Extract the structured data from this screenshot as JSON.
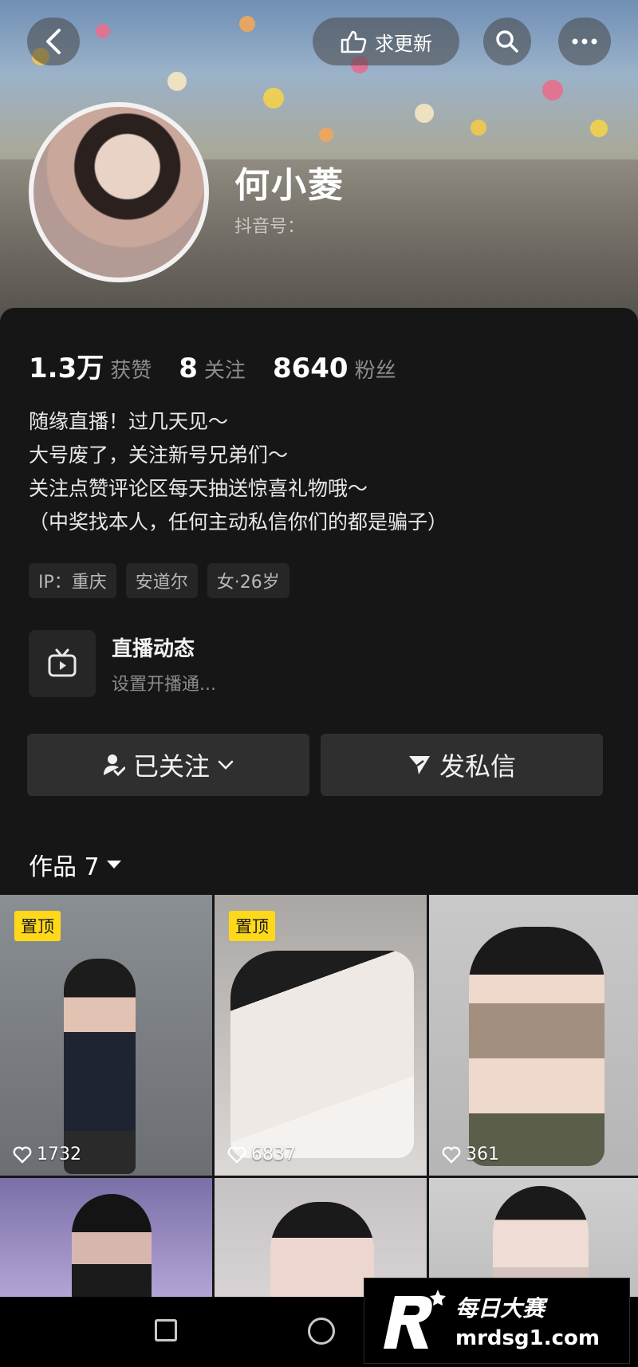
{
  "header": {
    "update_label": "求更新"
  },
  "profile": {
    "name": "何小菱",
    "douyin_id": "抖音号："
  },
  "stats": [
    {
      "value": "1.3万",
      "label": "获赞"
    },
    {
      "value": "8",
      "label": "关注"
    },
    {
      "value": "8640",
      "label": "粉丝"
    }
  ],
  "bio": [
    "随缘直播！过几天见～",
    "大号废了，关注新号兄弟们～",
    "关注点赞评论区每天抽送惊喜礼物哦～",
    "（中奖找本人，任何主动私信你们的都是骗子）"
  ],
  "tags": [
    "IP：重庆",
    "安道尔",
    "女·26岁"
  ],
  "live": {
    "title": "直播动态",
    "subtitle": "设置开播通..."
  },
  "actions": {
    "follow_label": "已关注",
    "message_label": "发私信"
  },
  "works": {
    "tab_label": "作品 7"
  },
  "grid": [
    {
      "pinned": "置顶",
      "likes": "1732"
    },
    {
      "pinned": "置顶",
      "likes": "6837"
    },
    {
      "pinned": "",
      "likes": "361"
    },
    {
      "pinned": "",
      "likes": ""
    },
    {
      "pinned": "",
      "likes": ""
    },
    {
      "pinned": "",
      "likes": ""
    }
  ],
  "watermark": {
    "title": "每日大赛",
    "url": "mrdsg1.com"
  },
  "colors": {
    "background": "#161616",
    "pin_badge": "#ffd81a",
    "button": "#2f2f2f"
  }
}
